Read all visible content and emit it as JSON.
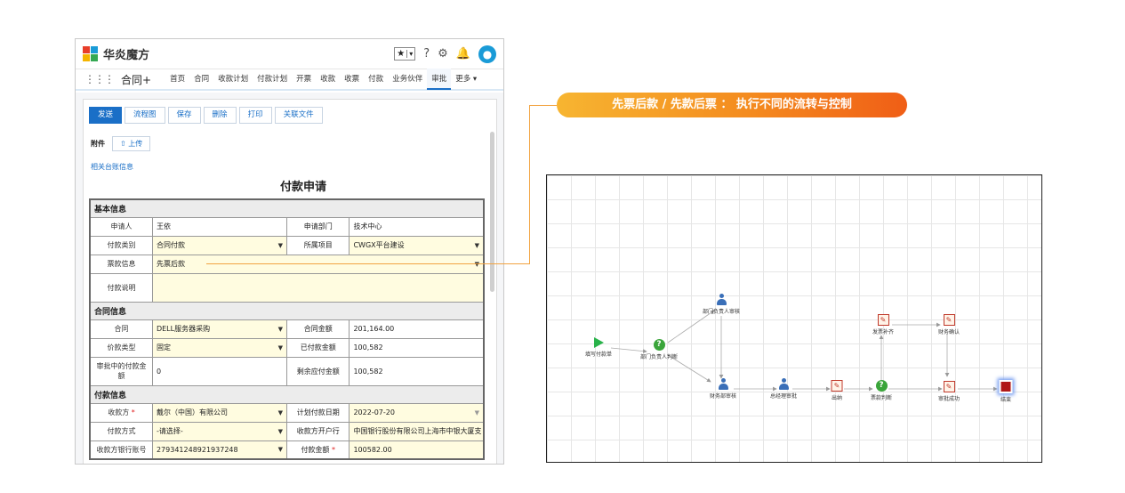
{
  "app": {
    "brand": "华炎魔方",
    "app_name": "合同+",
    "nav": [
      "首页",
      "合同",
      "收款计划",
      "付款计划",
      "开票",
      "收款",
      "收票",
      "付款",
      "业务伙伴",
      "审批",
      "更多 ▾"
    ],
    "active_nav": "审批"
  },
  "toolbar": {
    "buttons": [
      "发送",
      "流程图",
      "保存",
      "删除",
      "打印",
      "关联文件"
    ]
  },
  "attachment": {
    "label": "附件",
    "upload": "上传"
  },
  "related_link": "相关台账信息",
  "form": {
    "title": "付款申请",
    "sections": {
      "basic": "基本信息",
      "contract": "合同信息",
      "payment": "付款信息"
    },
    "fields": {
      "applicant_label": "申请人",
      "applicant": "王依",
      "dept_label": "申请部门",
      "dept": "技术中心",
      "pay_type_label": "付款类别",
      "pay_type": "合同付款",
      "project_label": "所属项目",
      "project": "CWGX平台建设",
      "invoice_label": "票款信息",
      "invoice": "先票后款",
      "desc_label": "付款说明",
      "desc": "",
      "contract_label": "合同",
      "contract": "DELL服务器采购",
      "contract_amt_label": "合同金额",
      "contract_amt": "201,164.00",
      "price_type_label": "价款类型",
      "price_type": "固定",
      "paid_label": "已付款金额",
      "paid": "100,582",
      "pending_label": "审批中的付款金额",
      "pending": "0",
      "remaining_label": "剩余应付金额",
      "remaining": "100,582",
      "payee_label": "收款方",
      "payee": "戴尔（中国）有限公司",
      "plan_date_label": "计划付款日期",
      "plan_date": "2022-07-20",
      "method_label": "付款方式",
      "method": "-请选择-",
      "bank_label": "收款方开户行",
      "bank": "中国银行股份有限公司上海市中银大厦支",
      "account_label": "收款方银行账号",
      "account": "279341248921937248",
      "amount_label": "付款金额",
      "amount": "100582.00"
    }
  },
  "banner": "先票后款 / 先款后票 ： 执行不同的流转与控制",
  "flow": {
    "nodes": {
      "start": "填写付款单",
      "dept_judge": "部门负责人判断",
      "dept_approve": "部门负责人审核",
      "finance_approve": "财务部审核",
      "gm_approve": "总经理审批",
      "cashier": "出纳",
      "invoice_judge": "票款判断",
      "invoice_supp": "发票补齐",
      "finance_confirm": "财务确认",
      "approve_success": "审批成功",
      "end": "结束"
    }
  },
  "colors": {
    "accent": "#1a6fc7",
    "banner_start": "#f7b531",
    "banner_end": "#f05e16",
    "highlight": "#fffce0"
  }
}
